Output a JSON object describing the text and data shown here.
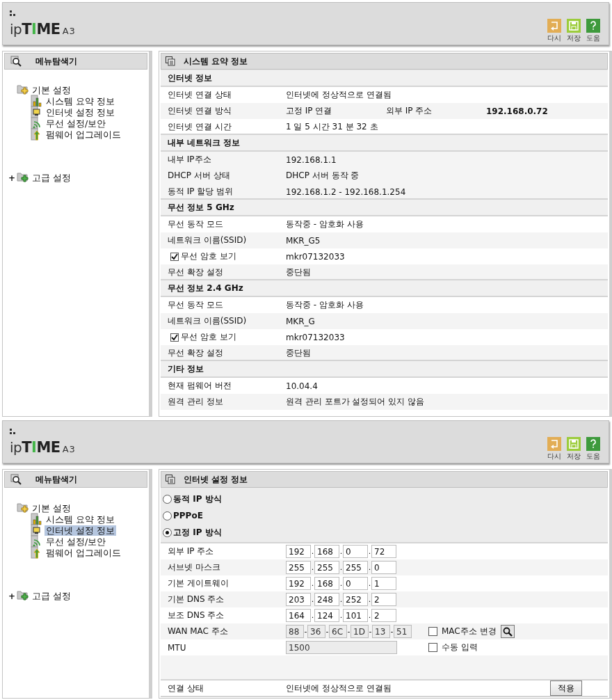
{
  "screens": [
    {
      "header": {
        "logo": "ipTIME",
        "model": "A3",
        "tools": [
          {
            "kind": "undo",
            "label": "다시"
          },
          {
            "kind": "save",
            "label": "저장"
          },
          {
            "kind": "help",
            "label": "도움"
          }
        ]
      },
      "sidebar": {
        "title": "메뉴탐색기",
        "tree": [
          {
            "label": "기본 설정",
            "kind": "basic",
            "expanded": true,
            "selected": false,
            "children": [
              {
                "label": "시스템 요약 정보",
                "kind": "chart",
                "selected": false
              },
              {
                "label": "인터넷 설정 정보",
                "kind": "monitor",
                "selected": false
              },
              {
                "label": "무선 설정/보안",
                "kind": "wireless",
                "selected": false
              },
              {
                "label": "펌웨어 업그레이드",
                "kind": "upgrade",
                "selected": false
              }
            ]
          },
          {
            "label": "고급 설정",
            "kind": "advanced",
            "expanded": false,
            "selected": false,
            "expander": "+"
          }
        ]
      },
      "content": {
        "kind": "summary",
        "title": "시스템 요약 정보",
        "sections": [
          {
            "title": "인터넷 정보",
            "rows": [
              {
                "label": "인터넷 연결 상태",
                "value": "인터넷에 정상적으로 연결됨"
              },
              {
                "label": "인터넷 연결 방식",
                "value": "고정 IP 연결",
                "extra_label": "외부 IP 주소",
                "extra_value": "192.168.0.72"
              },
              {
                "label": "인터넷 연결 시간",
                "value": "1 일 5 시간 31 분 32 초"
              }
            ]
          },
          {
            "title": "내부 네트워크 정보",
            "rows": [
              {
                "label": "내부 IP주소",
                "value": "192.168.1.1"
              },
              {
                "label": "DHCP 서버 상태",
                "value": "DHCP 서버 동작 중"
              },
              {
                "label": "동적 IP 할당 범위",
                "value": "192.168.1.2 -  192.168.1.254"
              }
            ]
          },
          {
            "title": "무선 정보 5 GHz",
            "rows": [
              {
                "label": "무선 동작 모드",
                "value": "동작중 - 암호화 사용"
              },
              {
                "label": "네트워크 이름(SSID)",
                "value": "MKR_G5"
              },
              {
                "kind": "checkbox",
                "checked": true,
                "label": "무선 암호 보기",
                "value": "mkr07132033"
              },
              {
                "label": "무선 확장 설정",
                "value": "중단됨"
              }
            ]
          },
          {
            "title": "무선 정보 2.4 GHz",
            "rows": [
              {
                "label": "무선 동작 모드",
                "value": "동작중 - 암호화 사용"
              },
              {
                "label": "네트워크 이름(SSID)",
                "value": "MKR_G"
              },
              {
                "kind": "checkbox",
                "checked": true,
                "label": "무선 암호 보기",
                "value": "mkr07132033"
              },
              {
                "label": "무선 확장 설정",
                "value": "중단됨"
              }
            ]
          },
          {
            "title": "기타 정보",
            "rows": [
              {
                "label": "현재 펌웨어 버전",
                "value": "10.04.4"
              },
              {
                "label": "원격 관리 정보",
                "value": "원격 관리 포트가 설정되어 있지 않음"
              }
            ]
          }
        ]
      }
    },
    {
      "header": {
        "logo": "ipTIME",
        "model": "A3",
        "tools": [
          {
            "kind": "undo",
            "label": "다시"
          },
          {
            "kind": "save",
            "label": "저장"
          },
          {
            "kind": "help",
            "label": "도움"
          }
        ]
      },
      "sidebar": {
        "title": "메뉴탐색기",
        "tree": [
          {
            "label": "기본 설정",
            "kind": "basic",
            "expanded": true,
            "selected": false,
            "children": [
              {
                "label": "시스템 요약 정보",
                "kind": "chart",
                "selected": false
              },
              {
                "label": "인터넷 설정 정보",
                "kind": "monitor",
                "selected": true
              },
              {
                "label": "무선 설정/보안",
                "kind": "wireless",
                "selected": false
              },
              {
                "label": "펌웨어 업그레이드",
                "kind": "upgrade",
                "selected": false
              }
            ]
          },
          {
            "label": "고급 설정",
            "kind": "advanced",
            "expanded": false,
            "selected": false,
            "expander": "+"
          }
        ]
      },
      "content": {
        "kind": "form",
        "title": "인터넷 설정 정보",
        "modes": [
          {
            "label": "동적 IP 방식",
            "selected": false
          },
          {
            "label": "PPPoE",
            "selected": false
          },
          {
            "label": "고정 IP 방식",
            "selected": true
          }
        ],
        "fields": [
          {
            "label": "외부 IP 주소",
            "kind": "address",
            "disabled": false,
            "parts": [
              {
                "value": "192"
              },
              {
                "separator": ".",
                "value": "168"
              },
              {
                "separator": ".",
                "value": "0"
              },
              {
                "separator": ".",
                "value": "72"
              }
            ]
          },
          {
            "label": "서브넷 마스크",
            "kind": "address",
            "disabled": false,
            "parts": [
              {
                "value": "255"
              },
              {
                "separator": ".",
                "value": "255"
              },
              {
                "separator": ".",
                "value": "255"
              },
              {
                "separator": ".",
                "value": "0"
              }
            ]
          },
          {
            "label": "기본 게이트웨이",
            "kind": "address",
            "disabled": false,
            "parts": [
              {
                "value": "192"
              },
              {
                "separator": ".",
                "value": "168"
              },
              {
                "separator": ".",
                "value": "0"
              },
              {
                "separator": ".",
                "value": "1"
              }
            ]
          },
          {
            "label": "기본 DNS 주소",
            "kind": "address",
            "disabled": false,
            "parts": [
              {
                "value": "203"
              },
              {
                "separator": ".",
                "value": "248"
              },
              {
                "separator": ".",
                "value": "252"
              },
              {
                "separator": ".",
                "value": "2"
              }
            ]
          },
          {
            "label": "보조 DNS 주소",
            "kind": "address",
            "disabled": false,
            "parts": [
              {
                "value": "164"
              },
              {
                "separator": ".",
                "value": "124"
              },
              {
                "separator": ".",
                "value": "101"
              },
              {
                "separator": ".",
                "value": "2"
              }
            ]
          },
          {
            "label": "WAN MAC 주소",
            "kind": "mac",
            "disabled": true,
            "parts": [
              {
                "value": "88"
              },
              {
                "separator": "-",
                "value": "36"
              },
              {
                "separator": "-",
                "value": "6C"
              },
              {
                "separator": "-",
                "value": "1D"
              },
              {
                "separator": "-",
                "value": "13"
              },
              {
                "separator": "-",
                "value": "51"
              }
            ],
            "option": {
              "label": "MAC주소 변경",
              "checked": false,
              "search": true
            }
          },
          {
            "label": "MTU",
            "kind": "single",
            "disabled": true,
            "value": "1500",
            "option": {
              "label": "수동 입력",
              "checked": false
            }
          }
        ],
        "status": {
          "label": "연결 상태",
          "value": "인터넷에 정상적으로 연결됨",
          "button": "적용"
        }
      }
    }
  ]
}
